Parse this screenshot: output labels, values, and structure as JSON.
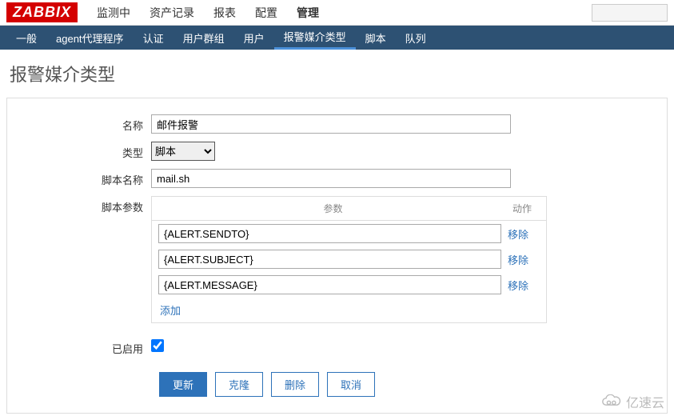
{
  "logo": "ZABBIX",
  "topMenu": {
    "items": [
      "监测中",
      "资产记录",
      "报表",
      "配置",
      "管理"
    ],
    "activeIndex": 4
  },
  "subNav": {
    "items": [
      "一般",
      "agent代理程序",
      "认证",
      "用户群组",
      "用户",
      "报警媒介类型",
      "脚本",
      "队列"
    ],
    "activeIndex": 5
  },
  "pageTitle": "报警媒介类型",
  "form": {
    "nameLabel": "名称",
    "nameValue": "邮件报警",
    "typeLabel": "类型",
    "typeValue": "脚本",
    "scriptNameLabel": "脚本名称",
    "scriptNameValue": "mail.sh",
    "scriptParamsLabel": "脚本参数",
    "paramsHeader": "参数",
    "actionHeader": "动作",
    "params": [
      {
        "value": "{ALERT.SENDTO}",
        "remove": "移除"
      },
      {
        "value": "{ALERT.SUBJECT}",
        "remove": "移除"
      },
      {
        "value": "{ALERT.MESSAGE}",
        "remove": "移除"
      }
    ],
    "addLabel": "添加",
    "enabledLabel": "已启用",
    "enabledChecked": true
  },
  "buttons": {
    "update": "更新",
    "clone": "克隆",
    "delete": "删除",
    "cancel": "取消"
  },
  "watermark": "亿速云"
}
